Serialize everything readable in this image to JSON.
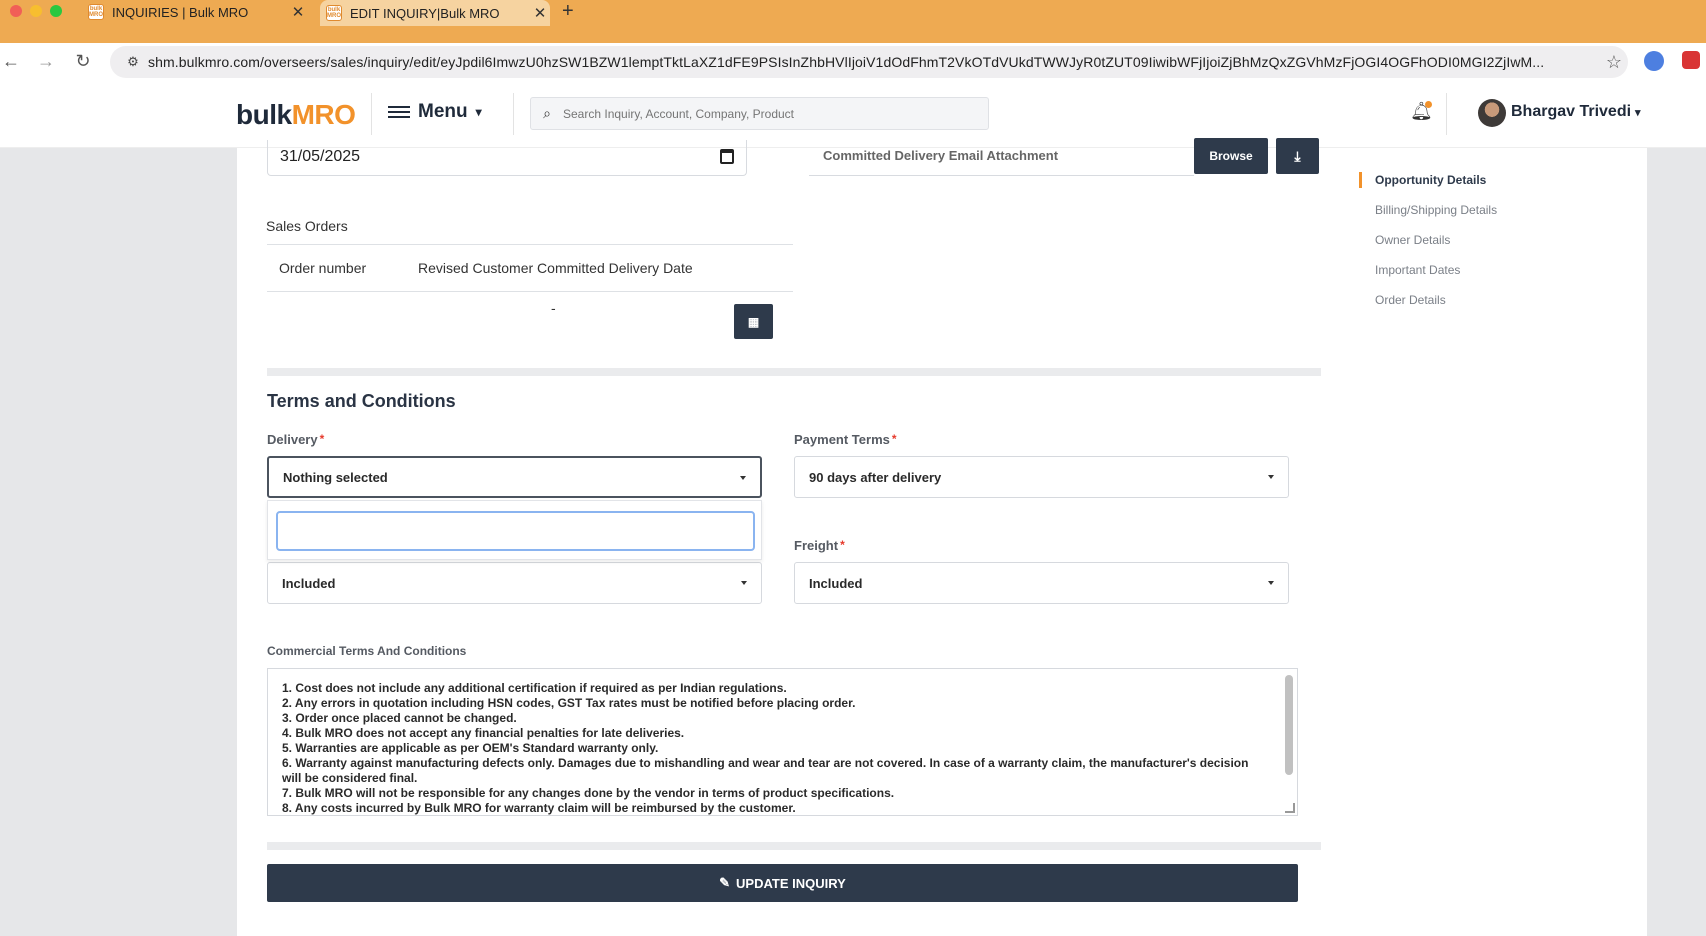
{
  "browser": {
    "tabs": [
      {
        "label": "INQUIRIES | Bulk MRO",
        "favicon": "bulk MRO"
      },
      {
        "label": "EDIT INQUIRY|Bulk MRO",
        "favicon": "bulk MRO"
      }
    ],
    "new_tab": "+",
    "url": "shm.bulkmro.com/overseers/sales/inquiry/edit/eyJpdil6ImwzU0hzSW1BZW1lemptTktLaXZ1dFE9PSIsInZhbHVlIjoiV1dOdFhmT2VkOTdVUkdTWWJyR0tZUT09IiwibWFjIjoiZjBhMzQxZGVhMzFjOGI4OGFhODI0MGI2ZjIwM..."
  },
  "header": {
    "logo_bulk": "bulk",
    "logo_mro": "MRO",
    "menu_label": "Menu",
    "search_placeholder": "Search Inquiry, Account, Company, Product",
    "user_name": "Bhargav Trivedi"
  },
  "top_fields": {
    "date_value": "31/05/2025",
    "attachment_label": "Committed Delivery Email Attachment",
    "browse_label": "Browse"
  },
  "sales_orders": {
    "title": "Sales Orders",
    "columns": [
      "Order number",
      "Revised Customer Committed Delivery Date"
    ],
    "row_value": "-"
  },
  "terms": {
    "section_title": "Terms and Conditions",
    "delivery": {
      "label": "Delivery",
      "value": "Nothing selected"
    },
    "payment_terms": {
      "label": "Payment Terms",
      "value": "90 days after delivery"
    },
    "left_select_value": "Included",
    "freight": {
      "label": "Freight",
      "value": "Included"
    },
    "commercial_label": "Commercial Terms And Conditions",
    "commercial_lines": [
      "1. Cost does not include any additional certification if required as per Indian regulations.",
      "2. Any errors in quotation including HSN codes, GST Tax rates must be notified before placing order.",
      "3. Order once placed cannot be changed.",
      "4. Bulk MRO does not accept any financial penalties for late deliveries.",
      "5. Warranties are applicable as per OEM's Standard warranty only.",
      "6. Warranty against manufacturing defects only. Damages due to mishandling and wear and tear are not covered. In case of a warranty claim, the manufacturer's decision will be considered final.",
      "7. Bulk MRO will not be responsible for any changes done by the vendor in terms of product specifications.",
      "8. Any costs incurred by Bulk MRO for warranty claim will be reimbursed by the customer."
    ]
  },
  "update_button": "UPDATE INQUIRY",
  "side_nav": [
    {
      "label": "Opportunity Details",
      "active": true
    },
    {
      "label": "Billing/Shipping Details",
      "active": false
    },
    {
      "label": "Owner Details",
      "active": false
    },
    {
      "label": "Important Dates",
      "active": false
    },
    {
      "label": "Order Details",
      "active": false
    }
  ],
  "colors": {
    "brand_orange": "#f2922b",
    "brand_dark": "#2e3a4b",
    "required_red": "#e63a2c"
  }
}
